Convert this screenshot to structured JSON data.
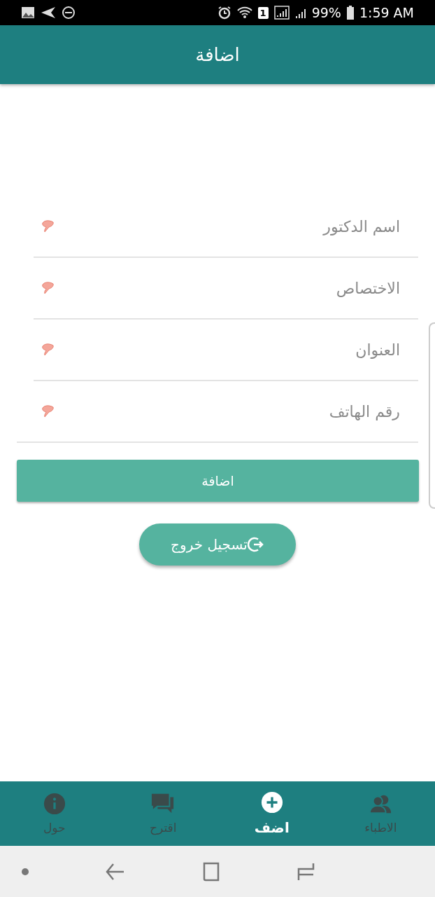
{
  "status_bar": {
    "sim": "1",
    "battery": "99%",
    "time": "1:59 AM"
  },
  "app_bar": {
    "title": "اضافة"
  },
  "fields": [
    {
      "placeholder": "اسم الدكتور"
    },
    {
      "placeholder": "الاختصاص"
    },
    {
      "placeholder": "العنوان"
    },
    {
      "placeholder": "رقم الهاتف"
    }
  ],
  "submit_button": "اضافة",
  "logout_button": "تسجيل خروج",
  "bottom_nav": [
    {
      "label": "الاطباء",
      "kind": "people",
      "selected": false
    },
    {
      "label": "اضف",
      "kind": "add",
      "selected": true
    },
    {
      "label": "اقترح",
      "kind": "chat",
      "selected": false
    },
    {
      "label": "حول",
      "kind": "info",
      "selected": false
    }
  ]
}
